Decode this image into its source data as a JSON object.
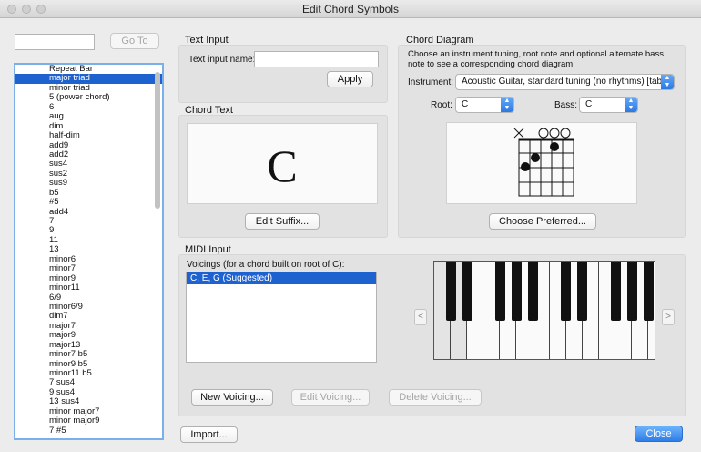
{
  "window": {
    "title": "Edit Chord Symbols"
  },
  "search": {
    "value": "",
    "go_label": "Go To"
  },
  "chord_list": {
    "items": [
      "Repeat Bar",
      "major triad",
      "minor triad",
      "5 (power chord)",
      "6",
      "aug",
      "dim",
      "half-dim",
      "add9",
      "add2",
      "sus4",
      "sus2",
      "sus9",
      "b5",
      "#5",
      "add4",
      "7",
      "9",
      "11",
      "13",
      "minor6",
      "minor7",
      "minor9",
      "minor11",
      "6/9",
      "minor6/9",
      "dim7",
      "major7",
      "major9",
      "major13",
      "minor7 b5",
      "minor9 b5",
      "minor11 b5",
      "7 sus4",
      "9 sus4",
      "13 sus4",
      "minor major7",
      "minor major9",
      "7 #5"
    ],
    "selected_index": 1
  },
  "text_input": {
    "group_title": "Text Input",
    "name_label": "Text input name:",
    "name_value": "",
    "apply_label": "Apply"
  },
  "chord_text": {
    "group_title": "Chord Text",
    "preview_symbol": "C",
    "edit_suffix_label": "Edit Suffix..."
  },
  "chord_diagram": {
    "group_title": "Chord Diagram",
    "description": "Choose an instrument tuning, root note and optional alternate bass note to see a corresponding chord diagram.",
    "instrument_label": "Instrument:",
    "instrument_value": "Acoustic Guitar, standard tuning (no rhythms) [tab]",
    "root_label": "Root:",
    "root_value": "C",
    "bass_label": "Bass:",
    "bass_value": "C",
    "choose_preferred_label": "Choose Preferred..."
  },
  "midi_input": {
    "group_title": "MIDI Input",
    "voicings_label": "Voicings (for a chord built on root of C):",
    "voicings": [
      "C, E, G (Suggested)"
    ],
    "selected_voicing": 0,
    "new_voicing_label": "New Voicing...",
    "edit_voicing_label": "Edit Voicing...",
    "delete_voicing_label": "Delete Voicing...",
    "scroll_left_label": "<",
    "scroll_right_label": ">"
  },
  "footer": {
    "import_label": "Import...",
    "close_label": "Close"
  },
  "icons": {
    "arrows": "popup-arrows-icon",
    "chord_diagram": "guitar-chord-diagram-icon",
    "keyboard": "piano-keyboard-icon"
  },
  "colors": {
    "selection": "#1e62d0",
    "default_button": "#2f7de8",
    "focus_ring": "#7ab0ea"
  }
}
